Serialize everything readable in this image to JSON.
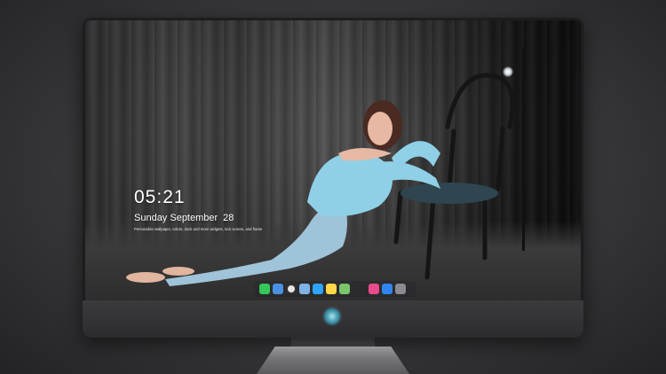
{
  "lock_screen": {
    "time": "05:21",
    "date_day": "Sunday September",
    "date_num": "28",
    "caption": "Personalize wallpaper, colors, dock and more widgets, lock screen, and frame"
  },
  "dock": {
    "items": [
      {
        "name": "messages-icon",
        "color": "#34c759"
      },
      {
        "name": "weather-icon",
        "color": "#4a90e2"
      },
      {
        "name": "clock-icon",
        "color": "#e6e6e6"
      },
      {
        "name": "files-icon",
        "color": "#7fb2e6"
      },
      {
        "name": "video-icon",
        "color": "#2fa4ff"
      },
      {
        "name": "notes-icon",
        "color": "#ffd84a"
      },
      {
        "name": "photos-icon",
        "color": "#7ac46a"
      },
      {
        "name": "music-icon",
        "color": "#e94a8c"
      },
      {
        "name": "appstore-icon",
        "color": "#2f86f0"
      },
      {
        "name": "camera-icon",
        "color": "#8a8a90"
      }
    ]
  }
}
